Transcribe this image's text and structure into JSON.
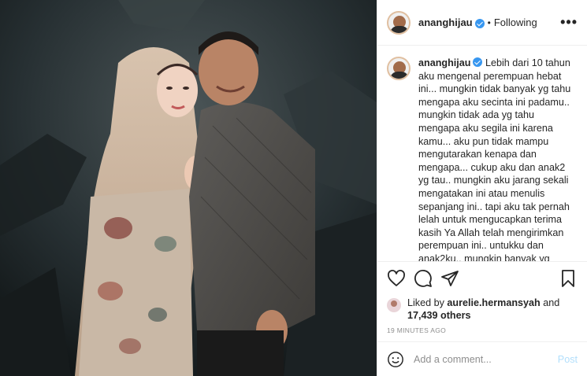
{
  "header": {
    "username": "ananghijau",
    "separator": "•",
    "follow_status": "Following",
    "more_label": "•••"
  },
  "caption": {
    "username": "ananghijau",
    "text": "Lebih dari 10 tahun aku mengenal perempuan hebat ini... mungkin tidak banyak yg tahu mengapa aku secinta ini padamu.. mungkin tidak ada yg tahu mengapa aku segila ini karena kamu... aku pun tidak mampu mengutarakan kenapa dan mengapa... cukup aku dan anak2 yg tau.. mungkin aku jarang sekali mengatakan ini atau menulis sepanjang ini.. tapi aku tak pernah lelah untuk mengucapkan terima kasih Ya Allah telah mengirimkan perempuan ini.. untukku dan anak2ku.. mungkin banyak yg menggapmu, tidak menghargai kehadiranmu, atau pun ingin menyakitimu..... tapi aku dan anak2 yg paling tahu bagaimana kamu.. perjuanganmu"
  },
  "icons": {
    "like": "heart-icon",
    "comment": "comment-icon",
    "share": "share-icon",
    "save": "bookmark-icon",
    "emoji": "emoji-icon"
  },
  "likes": {
    "prefix": "Liked by",
    "user": "aurelie.hermansyah",
    "and": "and",
    "count": "17,439 others"
  },
  "timestamp": "19 MINUTES AGO",
  "comment_box": {
    "placeholder": "Add a comment...",
    "post_label": "Post"
  },
  "colors": {
    "verified": "#3897f0",
    "post_button": "#b2dffc",
    "muted": "#8e8e8e"
  }
}
